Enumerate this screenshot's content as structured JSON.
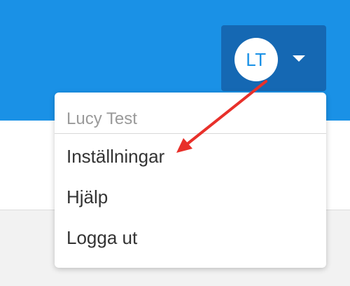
{
  "header": {
    "background_color": "#1a91e6",
    "user_menu": {
      "initials": "LT",
      "background_color": "#1568b3",
      "caret_icon": "caret-down-icon"
    }
  },
  "dropdown": {
    "user_name": "Lucy Test",
    "items": [
      {
        "label": "Inställningar"
      },
      {
        "label": "Hjälp"
      },
      {
        "label": "Logga ut"
      }
    ]
  },
  "annotation": {
    "arrow_color": "#e8302a"
  }
}
